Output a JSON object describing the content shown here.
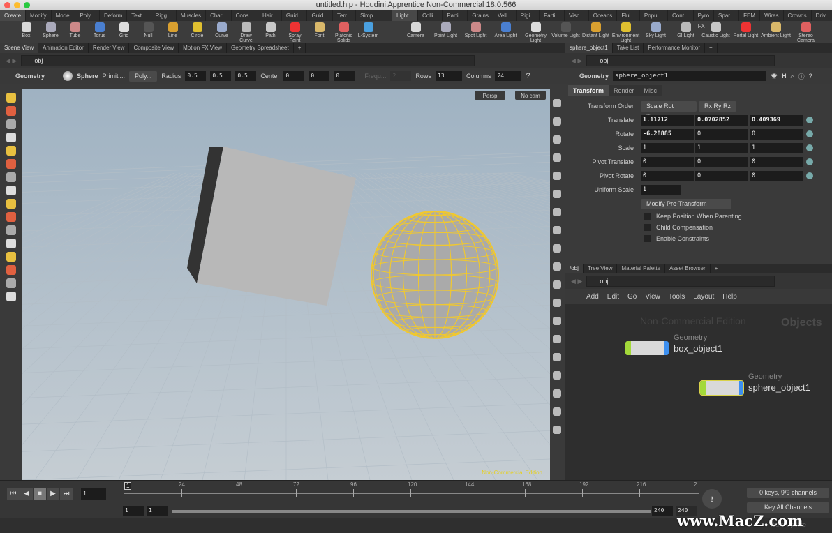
{
  "window": {
    "title": "untitled.hip - Houdini Apprentice Non-Commercial 18.0.566"
  },
  "shelf_left": {
    "tabs": [
      "Create",
      "Modify",
      "Model",
      "Poly...",
      "Deform",
      "Text...",
      "Rigg...",
      "Muscles",
      "Char...",
      "Cons...",
      "Hair...",
      "Guid...",
      "Guid...",
      "Terr...",
      "Simp..."
    ],
    "tools": [
      "Box",
      "Sphere",
      "Tube",
      "Torus",
      "Grid",
      "Null",
      "Line",
      "Circle",
      "Curve",
      "Draw Curve",
      "Path",
      "Spray Paint",
      "Font",
      "Platonic Solids",
      "L-System"
    ]
  },
  "shelf_right": {
    "tabs": [
      "Light...",
      "Colli...",
      "Parti...",
      "Grains",
      "Vell...",
      "Rigi...",
      "Parti...",
      "Visc...",
      "Oceans",
      "Flui...",
      "Popul...",
      "Cont...",
      "Pyro FX",
      "Spar...",
      "FEM",
      "Wires",
      "Crowds",
      "Driv..."
    ],
    "tools": [
      "Camera",
      "Point Light",
      "Spot Light",
      "Area Light",
      "Geometry Light",
      "Volume Light",
      "Distant Light",
      "Environment Light",
      "Sky Light",
      "GI Light",
      "Caustic Light",
      "Portal Light",
      "Ambient Light",
      "Stereo Camera"
    ]
  },
  "left_pane": {
    "tabs": [
      "Scene View",
      "Animation Editor",
      "Render View",
      "Composite View",
      "Motion FX View",
      "Geometry Spreadsheet"
    ],
    "path": "obj"
  },
  "op_toolbar": {
    "context": "Geometry",
    "tool": "Sphere",
    "primitive_label": "Primiti...",
    "primitive_type": "Poly...",
    "radius_label": "Radius",
    "radius": [
      "0.5",
      "0.5",
      "0.5"
    ],
    "center_label": "Center",
    "center": [
      "0",
      "0",
      "0"
    ],
    "freq_label": "Frequ...",
    "freq": "2",
    "rows_label": "Rows",
    "rows": "13",
    "columns_label": "Columns",
    "columns": "24"
  },
  "viewport": {
    "camera": "Persp",
    "cam": "No cam",
    "watermark": "Non-Commercial Edition"
  },
  "params": {
    "tabs": [
      "sphere_object1",
      "Take List",
      "Performance Monitor"
    ],
    "path": "obj",
    "type": "Geometry",
    "name": "sphere_object1",
    "sub_tabs": [
      "Transform",
      "Render",
      "Misc"
    ],
    "transform_order_label": "Transform Order",
    "transform_order": "Scale Rot Trans",
    "rot_order": "Rx Ry Rz",
    "rows": [
      {
        "label": "Translate",
        "values": [
          "1.11712",
          "0.0702852",
          "0.409369"
        ]
      },
      {
        "label": "Rotate",
        "values": [
          "-6.28885",
          "0",
          "0"
        ]
      },
      {
        "label": "Scale",
        "values": [
          "1",
          "1",
          "1"
        ]
      },
      {
        "label": "Pivot Translate",
        "values": [
          "0",
          "0",
          "0"
        ]
      },
      {
        "label": "Pivot Rotate",
        "values": [
          "0",
          "0",
          "0"
        ]
      }
    ],
    "uniform_scale_label": "Uniform Scale",
    "uniform_scale": "1",
    "modify_pre": "Modify Pre-Transform",
    "checks": [
      "Keep Position When Parenting",
      "Child Compensation",
      "Enable Constraints"
    ]
  },
  "network": {
    "tabs": [
      "/obj",
      "Tree View",
      "Material Palette",
      "Asset Browser"
    ],
    "path": "obj",
    "menu": [
      "Add",
      "Edit",
      "Go",
      "View",
      "Tools",
      "Layout",
      "Help"
    ],
    "watermark": "Non-Commercial Edition",
    "context": "Objects",
    "nodes": [
      {
        "type": "Geometry",
        "name": "box_object1"
      },
      {
        "type": "Geometry",
        "name": "sphere_object1"
      }
    ]
  },
  "timeline": {
    "frame": "1",
    "ticks": [
      "24",
      "48",
      "72",
      "96",
      "120",
      "144",
      "168",
      "192",
      "216",
      "2"
    ],
    "start": "1",
    "start2": "1",
    "end": "240",
    "end2": "240",
    "keys": "0 keys, 9/9 channels",
    "key_all": "Key All Channels",
    "current_marker": "1"
  },
  "status": {
    "auto_update": "Auto Update",
    "site_watermark": "www.MacZ.com"
  }
}
